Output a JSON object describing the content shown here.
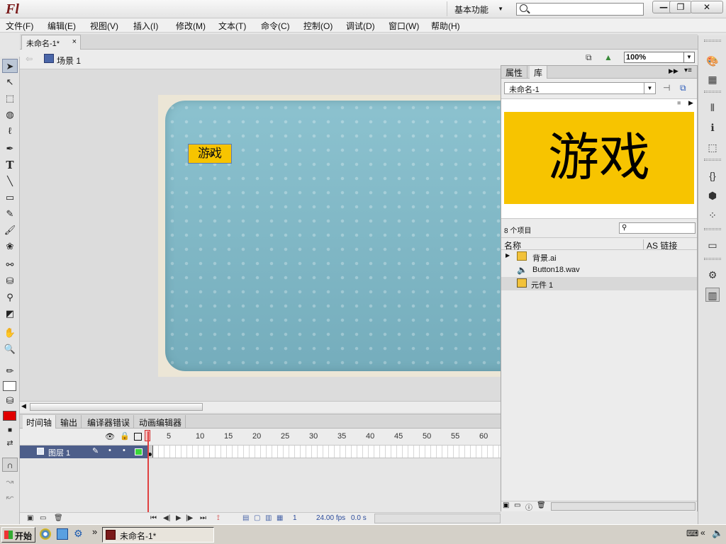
{
  "titlebar": {
    "app_logo": "Fl",
    "workspace_label": "基本功能",
    "search_placeholder": "",
    "min": "—",
    "max": "❐",
    "close": "✕"
  },
  "menubar": {
    "items": [
      "文件(F)",
      "编辑(E)",
      "视图(V)",
      "插入(I)",
      "修改(M)",
      "文本(T)",
      "命令(C)",
      "控制(O)",
      "调试(D)",
      "窗口(W)",
      "帮助(H)"
    ]
  },
  "doc_tab": {
    "label": "未命名-1*",
    "close": "×"
  },
  "editbar": {
    "scene_label": "场景 1",
    "zoom_value": "100%"
  },
  "stage": {
    "button_text": "游戏",
    "colors": {
      "stage_bg": "#7fb6c4",
      "button_bg": "#f7c400"
    }
  },
  "timeline": {
    "tabs": [
      "时间轴",
      "输出",
      "编译器错误",
      "动画编辑器"
    ],
    "frame_numbers": [
      "1",
      "5",
      "10",
      "15",
      "20",
      "25",
      "30",
      "35",
      "40",
      "45",
      "50",
      "55",
      "60"
    ],
    "layer_name": "图层 1",
    "current_frame": "1",
    "fps": "24.00",
    "fps_unit": "fps",
    "time": "0.0",
    "time_unit": "s"
  },
  "library": {
    "tabs": [
      "属性",
      "库"
    ],
    "document": "未命名-1",
    "preview_text": "游戏",
    "item_count": "8 个项目",
    "columns": {
      "name": "名称",
      "linkage": "AS 链接"
    },
    "items": [
      {
        "name": "背景.ai",
        "icon": "folder-icon"
      },
      {
        "name": "Button18.wav",
        "icon": "sound-icon"
      },
      {
        "name": "元件 1",
        "icon": "button-symbol-icon"
      }
    ]
  },
  "taskbar": {
    "start_label": "开始",
    "task_label": "未命名-1*",
    "chevron": "»"
  }
}
